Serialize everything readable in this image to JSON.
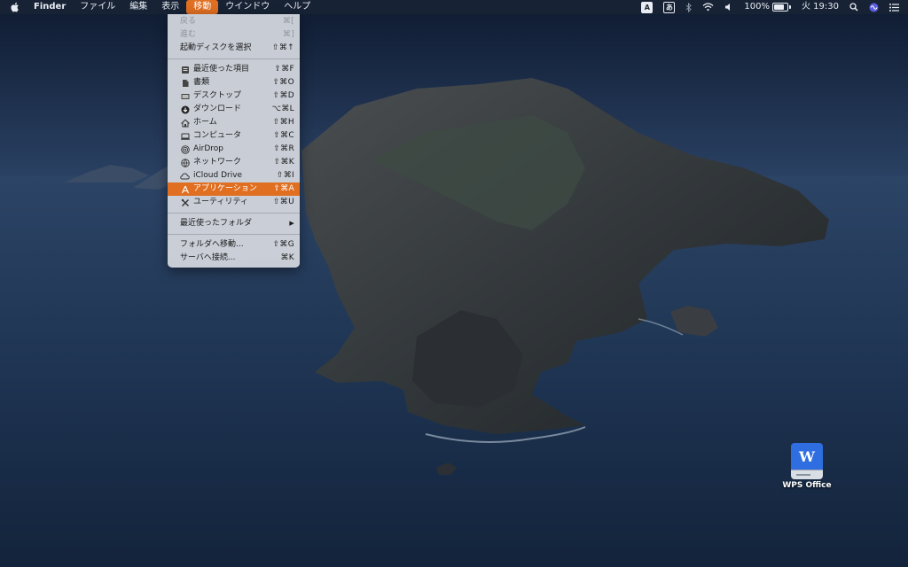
{
  "menubar": {
    "app_name": "Finder",
    "menus": [
      "ファイル",
      "編集",
      "表示",
      "移動",
      "ウインドウ",
      "ヘルプ"
    ],
    "active_menu": "移動",
    "status": {
      "input_method_a": "A",
      "input_method_b": "あ",
      "battery": "100%",
      "clock": "火 19:30"
    }
  },
  "go_menu": {
    "back": {
      "label": "戻る",
      "shortcut": "⌘["
    },
    "forward": {
      "label": "進む",
      "shortcut": "⌘]"
    },
    "startup_disk": {
      "label": "起動ディスクを選択",
      "shortcut": "⇧⌘↑"
    },
    "places": [
      {
        "label": "最近使った項目",
        "shortcut": "⇧⌘F",
        "icon": "recents-icon"
      },
      {
        "label": "書類",
        "shortcut": "⇧⌘O",
        "icon": "documents-icon"
      },
      {
        "label": "デスクトップ",
        "shortcut": "⇧⌘D",
        "icon": "desktop-icon"
      },
      {
        "label": "ダウンロード",
        "shortcut": "⌥⌘L",
        "icon": "downloads-icon"
      },
      {
        "label": "ホーム",
        "shortcut": "⇧⌘H",
        "icon": "home-icon"
      },
      {
        "label": "コンピュータ",
        "shortcut": "⇧⌘C",
        "icon": "computer-icon"
      },
      {
        "label": "AirDrop",
        "shortcut": "⇧⌘R",
        "icon": "airdrop-icon"
      },
      {
        "label": "ネットワーク",
        "shortcut": "⇧⌘K",
        "icon": "network-icon"
      },
      {
        "label": "iCloud Drive",
        "shortcut": "⇧⌘I",
        "icon": "icloud-icon"
      },
      {
        "label": "アプリケーション",
        "shortcut": "⇧⌘A",
        "icon": "applications-icon"
      },
      {
        "label": "ユーティリティ",
        "shortcut": "⇧⌘U",
        "icon": "utilities-icon"
      }
    ],
    "recent_folders": {
      "label": "最近使ったフォルダ",
      "arrow": "▶"
    },
    "goto_folder": {
      "label": "フォルダへ移動...",
      "shortcut": "⇧⌘G"
    },
    "connect_server": {
      "label": "サーバへ接続...",
      "shortcut": "⌘K"
    }
  },
  "desktop_icons": [
    {
      "label": "WPS Office",
      "glyph": "W",
      "icon": "wps-disk-icon",
      "color": "#2f6ee0"
    }
  ],
  "colors": {
    "highlight": "#e06f22",
    "menu_bg": "#d0d4dc"
  }
}
